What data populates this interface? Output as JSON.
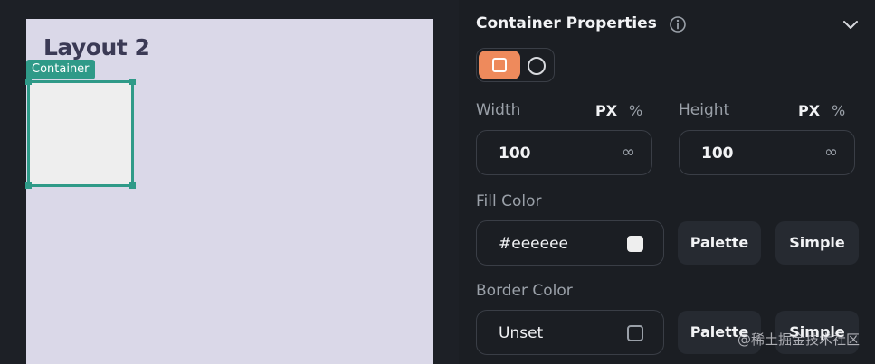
{
  "canvas": {
    "layout_title": "Layout 2",
    "container_tag": "Container"
  },
  "panel": {
    "title": "Container Properties",
    "width": {
      "label": "Width",
      "unit_px": "PX",
      "unit_pct": "%",
      "value": "100",
      "infinite_symbol": "∞"
    },
    "height": {
      "label": "Height",
      "unit_px": "PX",
      "unit_pct": "%",
      "value": "100",
      "infinite_symbol": "∞"
    },
    "fill_color": {
      "label": "Fill Color",
      "value": "#eeeeee",
      "swatch_color": "#eeeeee",
      "palette_label": "Palette",
      "simple_label": "Simple"
    },
    "border_color": {
      "label": "Border Color",
      "value": "Unset",
      "palette_label": "Palette",
      "simple_label": "Simple"
    }
  },
  "watermark": "@稀土掘金技术社区",
  "colors": {
    "accent_teal": "#2f9a88",
    "accent_orange": "#ee8a5c",
    "canvas_bg": "#dad8e8",
    "panel_bg": "#1b1e23"
  }
}
